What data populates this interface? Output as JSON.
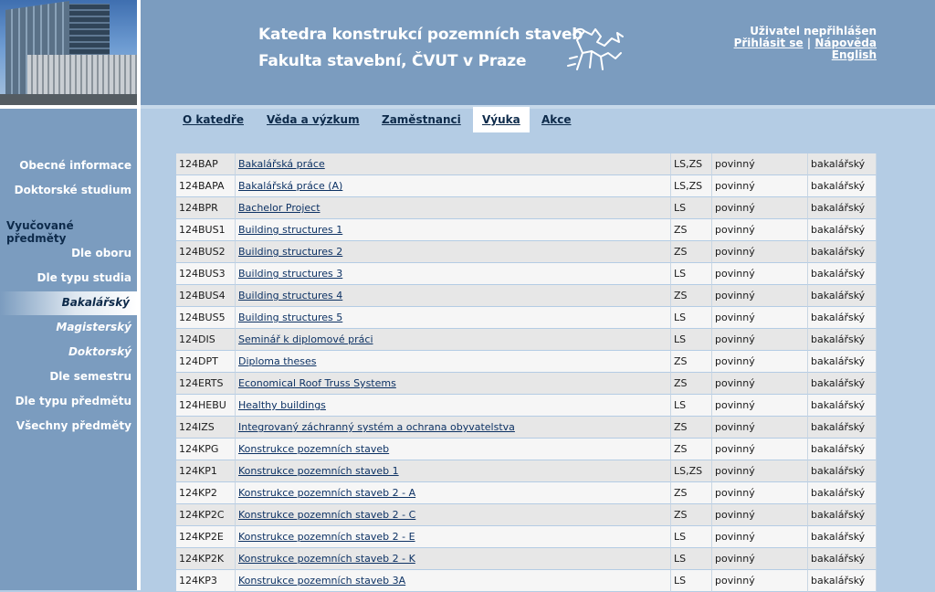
{
  "header": {
    "title_line1": "Katedra konstrukcí pozemních staveb",
    "title_line2": "Fakulta stavební, ČVUT v Praze",
    "user_status": "Uživatel nepřihlášen",
    "login_label": "Přihlásit se",
    "separator": "|",
    "help_label": "Nápověda",
    "english_label": "English"
  },
  "nav": {
    "tabs": [
      {
        "label": "O katedře"
      },
      {
        "label": "Věda a výzkum"
      },
      {
        "label": "Zaměstnanci"
      },
      {
        "label": "Výuka"
      },
      {
        "label": "Akce"
      }
    ],
    "active_tab": "Výuka"
  },
  "sidebar": {
    "general": "Obecné informace",
    "doctoral": "Doktorské studium",
    "section_heading": "Vyučované předměty",
    "by_field": "Dle oboru",
    "by_study_type": "Dle typu studia",
    "bachelor": "Bakalářský",
    "master": "Magisterský",
    "doctoral_sub": "Doktorský",
    "by_semester": "Dle semestru",
    "by_course_type": "Dle typu předmětu",
    "all_courses": "Všechny předměty"
  },
  "courses": [
    {
      "code": "124BAP",
      "name": "Bakalářská práce",
      "semester": "LS,ZS",
      "type": "povinný",
      "level": "bakalářský"
    },
    {
      "code": "124BAPA",
      "name": "Bakalářská práce (A)",
      "semester": "LS,ZS",
      "type": "povinný",
      "level": "bakalářský"
    },
    {
      "code": "124BPR",
      "name": "Bachelor Project",
      "semester": "LS",
      "type": "povinný",
      "level": "bakalářský"
    },
    {
      "code": "124BUS1",
      "name": "Building structures 1",
      "semester": "ZS",
      "type": "povinný",
      "level": "bakalářský"
    },
    {
      "code": "124BUS2",
      "name": "Building structures 2",
      "semester": "ZS",
      "type": "povinný",
      "level": "bakalářský"
    },
    {
      "code": "124BUS3",
      "name": "Building structures 3",
      "semester": "LS",
      "type": "povinný",
      "level": "bakalářský"
    },
    {
      "code": "124BUS4",
      "name": "Building structures 4",
      "semester": "ZS",
      "type": "povinný",
      "level": "bakalářský"
    },
    {
      "code": "124BUS5",
      "name": "Building structures 5",
      "semester": "LS",
      "type": "povinný",
      "level": "bakalářský"
    },
    {
      "code": "124DIS",
      "name": "Seminář k diplomové práci",
      "semester": "LS",
      "type": "povinný",
      "level": "bakalářský"
    },
    {
      "code": "124DPT",
      "name": "Diploma theses",
      "semester": "ZS",
      "type": "povinný",
      "level": "bakalářský"
    },
    {
      "code": "124ERTS",
      "name": "Economical Roof Truss Systems",
      "semester": "ZS",
      "type": "povinný",
      "level": "bakalářský"
    },
    {
      "code": "124HEBU",
      "name": "Healthy buildings",
      "semester": "LS",
      "type": "povinný",
      "level": "bakalářský"
    },
    {
      "code": "124IZS",
      "name": "Integrovaný záchranný systém a ochrana obyvatelstva",
      "semester": "ZS",
      "type": "povinný",
      "level": "bakalářský"
    },
    {
      "code": "124KPG",
      "name": "Konstrukce pozemních staveb",
      "semester": "ZS",
      "type": "povinný",
      "level": "bakalářský"
    },
    {
      "code": "124KP1",
      "name": "Konstrukce pozemních staveb 1",
      "semester": "LS,ZS",
      "type": "povinný",
      "level": "bakalářský"
    },
    {
      "code": "124KP2",
      "name": "Konstrukce pozemních staveb 2 - A",
      "semester": "ZS",
      "type": "povinný",
      "level": "bakalářský"
    },
    {
      "code": "124KP2C",
      "name": "Konstrukce pozemních staveb 2 - C",
      "semester": "ZS",
      "type": "povinný",
      "level": "bakalářský"
    },
    {
      "code": "124KP2E",
      "name": "Konstrukce pozemních staveb 2 - E",
      "semester": "LS",
      "type": "povinný",
      "level": "bakalářský"
    },
    {
      "code": "124KP2K",
      "name": "Konstrukce pozemních staveb 2 - K",
      "semester": "LS",
      "type": "povinný",
      "level": "bakalářský"
    },
    {
      "code": "124KP3",
      "name": "Konstrukce pozemních staveb 3A",
      "semester": "LS",
      "type": "povinný",
      "level": "bakalářský"
    }
  ],
  "colors": {
    "header_bg": "#7b9cbf",
    "page_bg": "#b4cce4",
    "link": "#0d3264",
    "row_odd": "#e7e7e7",
    "row_even": "#f6f6f6"
  },
  "icons": {
    "logo": "lion-crest-icon",
    "photo": "faculty-building-photo"
  }
}
